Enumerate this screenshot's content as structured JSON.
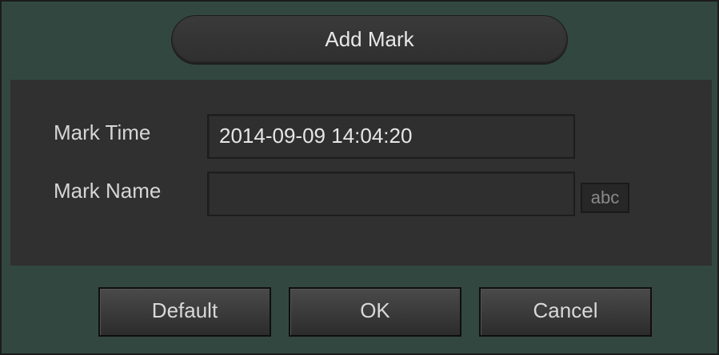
{
  "dialog": {
    "title": "Add Mark"
  },
  "form": {
    "mark_time_label": "Mark Time",
    "mark_time_value": "2014-09-09 14:04:20",
    "mark_name_label": "Mark Name",
    "mark_name_value": "",
    "keyboard_button_label": "abc"
  },
  "buttons": {
    "default_label": "Default",
    "ok_label": "OK",
    "cancel_label": "Cancel"
  },
  "colors": {
    "frame": "#334741",
    "panel": "#303030",
    "text": "#d6d6d6"
  }
}
